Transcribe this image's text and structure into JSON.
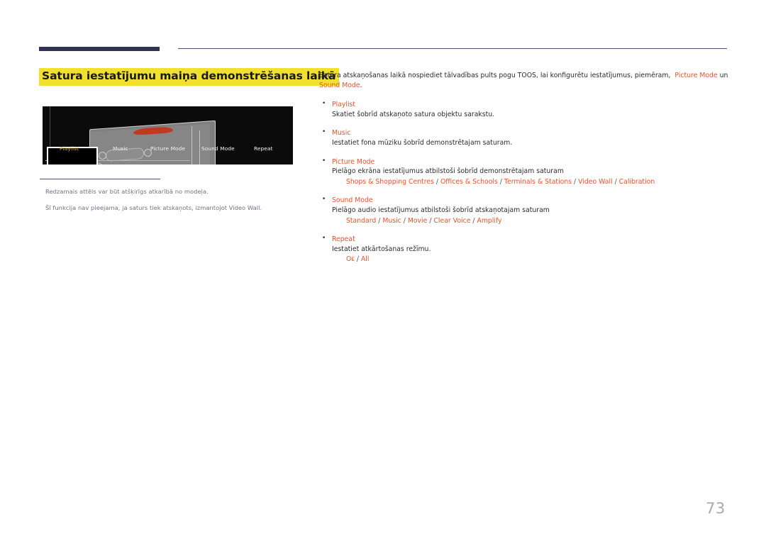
{
  "header": {
    "rule_thick_color": "#2e3354",
    "rule_thin_color": "#4b5070"
  },
  "title": {
    "text": "Satura iestatījumu maiņa demonstrēšanas laikā",
    "highlight_color": "#f2e02e"
  },
  "figure": {
    "alt_name": "remote-control-osd-menu",
    "background": "#0b0b0b",
    "menu_items": [
      {
        "label": "Playlist",
        "highlighted": true,
        "color": "#e0b422"
      },
      {
        "label": "Music",
        "highlighted": false,
        "color": "#f4f4f4"
      },
      {
        "label": "Picture Mode",
        "highlighted": false,
        "color": "#f4f4f4"
      },
      {
        "label": "Sound Mode",
        "highlighted": false,
        "color": "#f4f4f4"
      },
      {
        "label": "Repeat",
        "highlighted": false,
        "color": "#f4f4f4"
      }
    ]
  },
  "captions": [
    "Redzamais attēls var būt atšķirīgs atkarībā no modeļa.",
    "Šī funkcija nav pieejama, ja saturs tiek atskaņots, izmantojot Video Wall."
  ],
  "intro": {
    "part1": "Satura atskaņošanas laikā nospiediet tālvadības pults pogu TOOS, lai konfigurētu iestatījumus, piemēram,",
    "accent1": "Picture Mode",
    "part2": "un",
    "accent2": "Sound Mode",
    "part3": "."
  },
  "features": [
    {
      "name": "Playlist",
      "description": "Skatiet šobrīd atskaņoto satura objektu sarakstu.",
      "options": []
    },
    {
      "name": "Music",
      "description": "Iestatiet fona mūziku šobrīd demonstrētajam saturam.",
      "options": []
    },
    {
      "name": "Picture Mode",
      "description": "Pielāgo ekrāna iestatījumus atbilstoši šobrīd demonstrētajam saturam",
      "options": [
        "Shops & Shopping Centres",
        "Offices & Schools",
        "Terminals & Stations",
        "Video Wall",
        "Calibration"
      ]
    },
    {
      "name": "Sound Mode",
      "description": "Pielāgo audio iestatījumus atbilstoši šobrīd atskaņotajam saturam",
      "options": [
        "Standard",
        "Music",
        "Movie",
        "Clear Voice",
        "Amplify"
      ]
    },
    {
      "name": "Repeat",
      "description": "Iestatiet atkārtošanas režīmu.",
      "options": [
        "Oᴇ",
        "All"
      ]
    }
  ],
  "page_number": "73",
  "colors": {
    "accent": "#e8512c",
    "navy": "#2e3354",
    "caption": "#6c7285",
    "highlight_yellow": "#f2e02e",
    "page_number": "#a9a9a9"
  }
}
